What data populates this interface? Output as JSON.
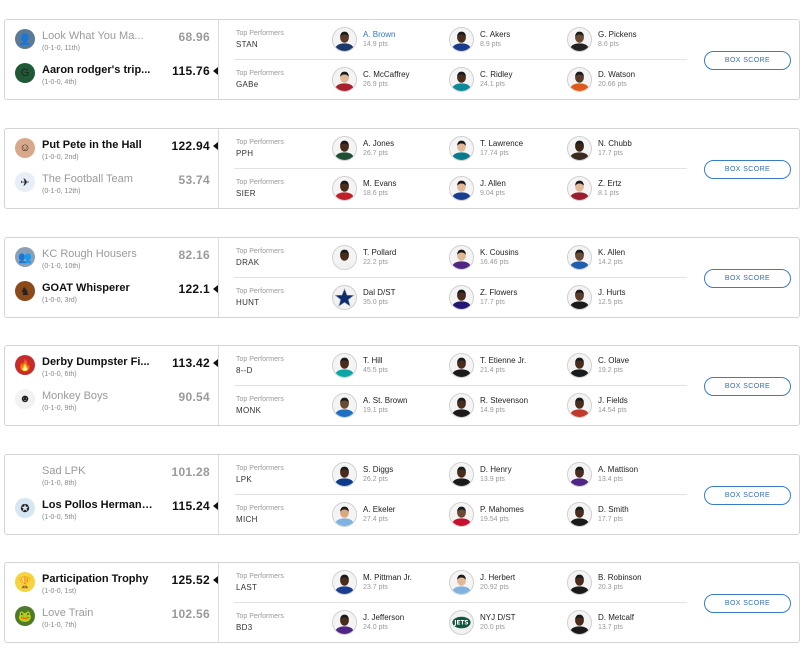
{
  "performers_label": "Top Performers",
  "box_score_label": "BOX SCORE",
  "matchups": [
    {
      "teams": [
        {
          "name": "Look What You Ma...",
          "record": "(0-1-0, 11th)",
          "score": "68.96",
          "winner": false,
          "logo_icon": "team-photo-icon",
          "logo_color": "#5b7a96",
          "logo_glyph": "👤"
        },
        {
          "name": "Aaron rodger's trip...",
          "record": "(1-0-0, 4th)",
          "score": "115.76",
          "winner": true,
          "logo_icon": "packers-logo-icon",
          "logo_color": "#1f5a37",
          "logo_glyph": "G"
        }
      ],
      "rows": [
        {
          "abbr": "STAN",
          "players": [
            {
              "name": "A. Brown",
              "pts": "14.9 pts",
              "link": true,
              "jersey": "#1a3a6b",
              "skin": "#5a3a28"
            },
            {
              "name": "C. Akers",
              "pts": "8.9 pts",
              "jersey": "#1a3a8b",
              "skin": "#4a2c1c"
            },
            {
              "name": "G. Pickens",
              "pts": "8.6 pts",
              "jersey": "#222222",
              "skin": "#6b4a33"
            }
          ]
        },
        {
          "abbr": "GABe",
          "players": [
            {
              "name": "C. McCaffrey",
              "pts": "26.9 pts",
              "jersey": "#aa1f2e",
              "skin": "#e2b998"
            },
            {
              "name": "C. Ridley",
              "pts": "24.1 pts",
              "jersey": "#0b8a9a",
              "skin": "#4a2c1c"
            },
            {
              "name": "D. Watson",
              "pts": "20.66 pts",
              "jersey": "#e05a1a",
              "skin": "#5a3a28"
            }
          ]
        }
      ]
    },
    {
      "teams": [
        {
          "name": "Put Pete in the Hall",
          "record": "(1-0-0, 2nd)",
          "score": "122.94",
          "winner": true,
          "logo_icon": "avatar-photo-icon",
          "logo_color": "#d8a88a",
          "logo_glyph": "☺"
        },
        {
          "name": "The Football Team",
          "record": "(0-1-0, 12th)",
          "score": "53.74",
          "winner": false,
          "logo_icon": "flag-logo-icon",
          "logo_color": "#e7eef8",
          "logo_glyph": "✈"
        }
      ],
      "rows": [
        {
          "abbr": "PPH",
          "players": [
            {
              "name": "A. Jones",
              "pts": "26.7 pts",
              "jersey": "#1f4e35",
              "skin": "#4a2c1c"
            },
            {
              "name": "T. Lawrence",
              "pts": "17.74 pts",
              "jersey": "#0b7a8a",
              "skin": "#e2b998"
            },
            {
              "name": "N. Chubb",
              "pts": "17.7 pts",
              "jersey": "#3a2a1f",
              "skin": "#3a2418"
            }
          ]
        },
        {
          "abbr": "SIER",
          "players": [
            {
              "name": "M. Evans",
              "pts": "18.6 pts",
              "jersey": "#c0202a",
              "skin": "#4a2c1c"
            },
            {
              "name": "J. Allen",
              "pts": "9.04 pts",
              "jersey": "#1a3d8f",
              "skin": "#e2b998"
            },
            {
              "name": "Z. Ertz",
              "pts": "8.1 pts",
              "jersey": "#9a1f2e",
              "skin": "#e2b998"
            }
          ]
        }
      ]
    },
    {
      "teams": [
        {
          "name": "KC Rough Housers",
          "record": "(0-1-0, 10th)",
          "score": "82.16",
          "winner": false,
          "logo_icon": "team-photo-icon",
          "logo_color": "#8aa0b8",
          "logo_glyph": "👥"
        },
        {
          "name": "GOAT Whisperer",
          "record": "(1-0-0, 3rd)",
          "score": "122.1",
          "winner": true,
          "logo_icon": "horse-logo-icon",
          "logo_color": "#8a4a1a",
          "logo_glyph": "♞"
        }
      ],
      "rows": [
        {
          "abbr": "DRAK",
          "players": [
            {
              "name": "T. Pollard",
              "pts": "22.2 pts",
              "jersey": "#f0f0f0",
              "skin": "#4a2c1c"
            },
            {
              "name": "K. Cousins",
              "pts": "16.46 pts",
              "jersey": "#4f2683",
              "skin": "#e2b998"
            },
            {
              "name": "K. Allen",
              "pts": "14.2 pts",
              "jersey": "#1f5fb0",
              "skin": "#6b4a33"
            }
          ]
        },
        {
          "abbr": "HUNT",
          "players": [
            {
              "name": "Dal D/ST",
              "pts": "35.0 pts",
              "jersey": "#ffffff",
              "skin": "#0c2c6b",
              "dst": "star"
            },
            {
              "name": "Z. Flowers",
              "pts": "17.7 pts",
              "jersey": "#241773",
              "skin": "#4a2c1c"
            },
            {
              "name": "J. Hurts",
              "pts": "12.5 pts",
              "jersey": "#1a1a1a",
              "skin": "#5a3a28"
            }
          ]
        }
      ]
    },
    {
      "teams": [
        {
          "name": "Derby Dumpster Fi...",
          "record": "(1-0-0, 6th)",
          "score": "113.42",
          "winner": true,
          "logo_icon": "dumpster-fire-logo-icon",
          "logo_color": "#c82b2b",
          "logo_glyph": "🔥"
        },
        {
          "name": "Monkey Boys",
          "record": "(0-1-0, 9th)",
          "score": "90.54",
          "winner": false,
          "logo_icon": "cartoon-face-logo-icon",
          "logo_color": "#f2f2f2",
          "logo_glyph": "☻"
        }
      ],
      "rows": [
        {
          "abbr": "8--D",
          "players": [
            {
              "name": "T. Hill",
              "pts": "45.5 pts",
              "jersey": "#0aa7a7",
              "skin": "#4a2c1c"
            },
            {
              "name": "T. Etienne Jr.",
              "pts": "21.4 pts",
              "jersey": "#1a1a1a",
              "skin": "#4a2c1c"
            },
            {
              "name": "C. Olave",
              "pts": "19.2 pts",
              "jersey": "#1a1a1a",
              "skin": "#4a2c1c"
            }
          ]
        },
        {
          "abbr": "MONK",
          "players": [
            {
              "name": "A. St. Brown",
              "pts": "19.1 pts",
              "jersey": "#1f6fc0",
              "skin": "#6b4a33"
            },
            {
              "name": "R. Stevenson",
              "pts": "14.9 pts",
              "jersey": "#1a1a1a",
              "skin": "#4a2c1c"
            },
            {
              "name": "J. Fields",
              "pts": "14.54 pts",
              "jersey": "#c0392b",
              "skin": "#4a2c1c"
            }
          ]
        }
      ]
    },
    {
      "teams": [
        {
          "name": "Sad LPK",
          "record": "(0-1-0, 8th)",
          "score": "101.28",
          "winner": false,
          "logo_icon": "blank-logo-icon",
          "logo_color": "#ffffff",
          "logo_glyph": ""
        },
        {
          "name": "Los Pollos Hermanos",
          "record": "(1-0-0, 5th)",
          "score": "115.24",
          "winner": true,
          "logo_icon": "pollos-logo-icon",
          "logo_color": "#d6e6f2",
          "logo_glyph": "✪"
        }
      ],
      "rows": [
        {
          "abbr": "LPK",
          "players": [
            {
              "name": "S. Diggs",
              "pts": "26.2 pts",
              "jersey": "#0c3b8c",
              "skin": "#4a2c1c"
            },
            {
              "name": "D. Henry",
              "pts": "13.9 pts",
              "jersey": "#1a1a1a",
              "skin": "#4a2c1c"
            },
            {
              "name": "A. Mattison",
              "pts": "13.4 pts",
              "jersey": "#4f2683",
              "skin": "#4a2c1c"
            }
          ]
        },
        {
          "abbr": "MICH",
          "players": [
            {
              "name": "A. Ekeler",
              "pts": "27.4 pts",
              "jersey": "#7fb2e0",
              "skin": "#d9a77f"
            },
            {
              "name": "P. Mahomes",
              "pts": "19.54 pts",
              "jersey": "#c8102e",
              "skin": "#6b4a33"
            },
            {
              "name": "D. Smith",
              "pts": "17.7 pts",
              "jersey": "#1a1a1a",
              "skin": "#4a2c1c"
            }
          ]
        }
      ]
    },
    {
      "teams": [
        {
          "name": "Participation Trophy",
          "record": "(1-0-0, 1st)",
          "score": "125.52",
          "winner": true,
          "logo_icon": "trophy-logo-icon",
          "logo_color": "#f5d442",
          "logo_glyph": "🏆"
        },
        {
          "name": "Love Train",
          "record": "(0-1-0, 7th)",
          "score": "102.56",
          "winner": false,
          "logo_icon": "cartoon-logo-icon",
          "logo_color": "#4f7a2a",
          "logo_glyph": "🐸"
        }
      ],
      "rows": [
        {
          "abbr": "LAST",
          "players": [
            {
              "name": "M. Pittman Jr.",
              "pts": "23.7 pts",
              "jersey": "#1a3d8f",
              "skin": "#4a2c1c"
            },
            {
              "name": "J. Herbert",
              "pts": "20.92 pts",
              "jersey": "#7fb2e0",
              "skin": "#e2b998"
            },
            {
              "name": "B. Robinson",
              "pts": "20.3 pts",
              "jersey": "#1a1a1a",
              "skin": "#4a2c1c"
            }
          ]
        },
        {
          "abbr": "BD3",
          "players": [
            {
              "name": "J. Jefferson",
              "pts": "24.0 pts",
              "jersey": "#4f2683",
              "skin": "#4a2c1c"
            },
            {
              "name": "NYJ D/ST",
              "pts": "20.0 pts",
              "jersey": "#ffffff",
              "skin": "#125740",
              "dst": "jets"
            },
            {
              "name": "D. Metcalf",
              "pts": "13.7 pts",
              "jersey": "#1a1a1a",
              "skin": "#4a2c1c"
            }
          ]
        }
      ]
    }
  ]
}
